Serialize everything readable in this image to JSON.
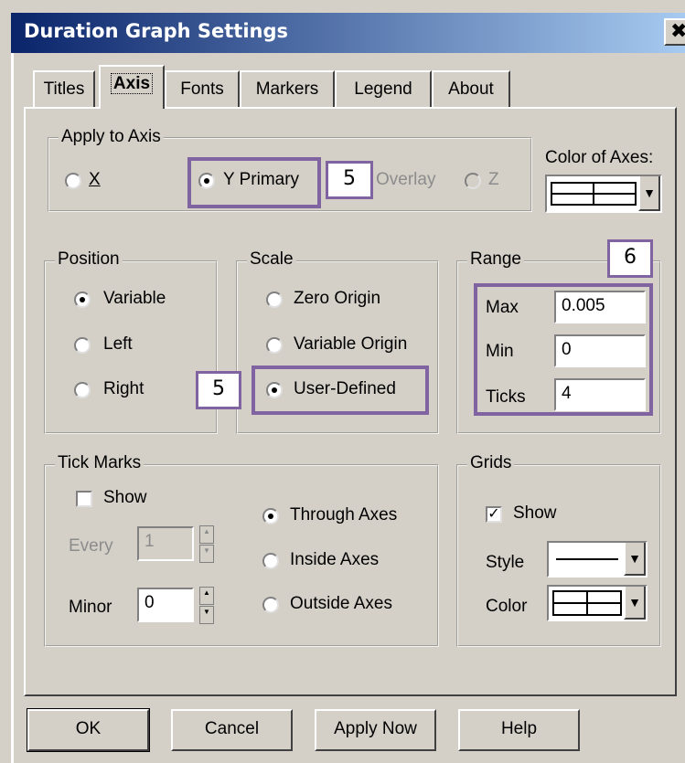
{
  "window": {
    "title": "Duration Graph Settings",
    "close_glyph": "✖"
  },
  "tabs": [
    {
      "label": "Titles",
      "active": false
    },
    {
      "label": "Axis",
      "active": true
    },
    {
      "label": "Fonts",
      "active": false
    },
    {
      "label": "Markers",
      "active": false
    },
    {
      "label": "Legend",
      "active": false
    },
    {
      "label": "About",
      "active": false
    }
  ],
  "apply_to_axis": {
    "legend": "Apply to Axis",
    "options": [
      {
        "label": "X",
        "selected": false,
        "enabled": true
      },
      {
        "label": "Y Primary",
        "selected": true,
        "enabled": true
      },
      {
        "label": "Overlay",
        "selected": false,
        "enabled": false
      },
      {
        "label": "Z",
        "selected": false,
        "enabled": false
      }
    ]
  },
  "color_of_axes": {
    "label": "Color of Axes:"
  },
  "position": {
    "legend": "Position",
    "options": [
      {
        "label": "Variable",
        "selected": true
      },
      {
        "label": "Left",
        "selected": false
      },
      {
        "label": "Right",
        "selected": false
      }
    ]
  },
  "scale": {
    "legend": "Scale",
    "options": [
      {
        "label": "Zero Origin",
        "selected": false
      },
      {
        "label": "Variable Origin",
        "selected": false
      },
      {
        "label": "User-Defined",
        "selected": true
      }
    ]
  },
  "range": {
    "legend": "Range",
    "max_label": "Max",
    "max_value": "0.005",
    "min_label": "Min",
    "min_value": "0",
    "ticks_label": "Ticks",
    "ticks_value": "4"
  },
  "tick_marks": {
    "legend": "Tick Marks",
    "show_label": "Show",
    "show_checked": false,
    "every_label": "Every",
    "every_value": "1",
    "minor_label": "Minor",
    "minor_value": "0",
    "options": [
      {
        "label": "Through Axes",
        "selected": true
      },
      {
        "label": "Inside Axes",
        "selected": false
      },
      {
        "label": "Outside Axes",
        "selected": false
      }
    ]
  },
  "grids": {
    "legend": "Grids",
    "show_label": "Show",
    "show_checked": true,
    "style_label": "Style",
    "color_label": "Color"
  },
  "buttons": {
    "ok": "OK",
    "cancel": "Cancel",
    "apply_now": "Apply Now",
    "help": "Help"
  },
  "annotations": {
    "callout_a": "5",
    "callout_b": "5",
    "callout_c": "6"
  },
  "colors": {
    "annotation": "#8064a2",
    "titlebar_start": "#0a246a",
    "titlebar_end": "#a6caf0",
    "face": "#d4d0c8"
  }
}
